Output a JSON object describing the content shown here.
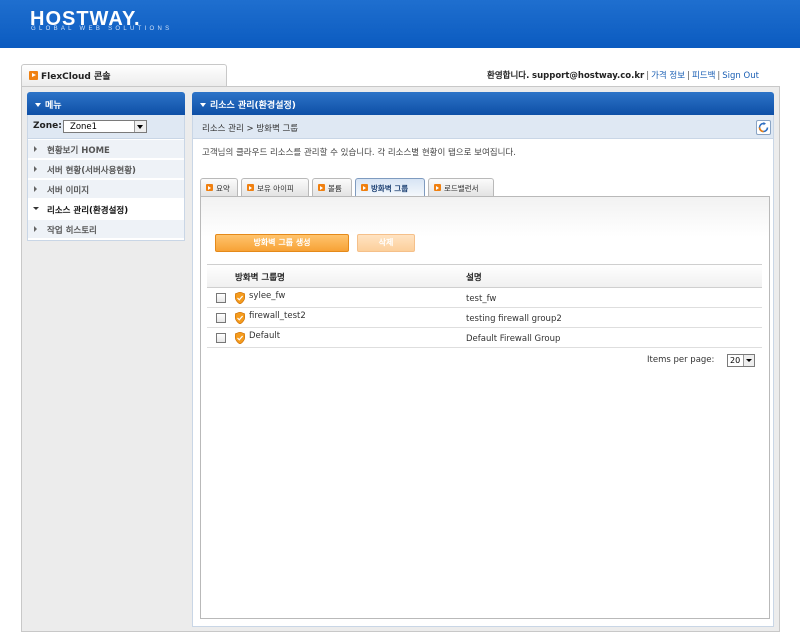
{
  "header": {
    "logo": "HOSTWAY.",
    "logo_sub": "GLOBAL WEB SOLUTIONS"
  },
  "app_tab": {
    "label": "FlexCloud 콘솔"
  },
  "user_bar": {
    "welcome": "환영합니다.",
    "email": "support@hostway.co.kr",
    "links": [
      "가격 정보",
      "피드백",
      "Sign Out"
    ]
  },
  "sidebar": {
    "title": "메뉴",
    "zone_label": "Zone:",
    "zone_value": "Zone1",
    "items": [
      {
        "label": "현황보기 HOME",
        "active": false
      },
      {
        "label": "서버 현황(서버사용현황)",
        "active": false
      },
      {
        "label": "서버 이미지",
        "active": false
      },
      {
        "label": "리소스 관리(환경설정)",
        "active": true
      },
      {
        "label": "작업 히스토리",
        "active": false
      }
    ]
  },
  "main": {
    "title": "리소스 관리(환경설정)",
    "breadcrumb": "리소스 관리 >  방화벽 그룹",
    "description": "고객님의 클라우드 리소스를 관리할 수 있습니다. 각 리소스별 현황이 탭으로 보여집니다.",
    "tabs": [
      {
        "label": "요약",
        "active": false
      },
      {
        "label": "보유 아이피",
        "active": false
      },
      {
        "label": "볼륨",
        "active": false
      },
      {
        "label": "방화벽 그룹",
        "active": true
      },
      {
        "label": "로드밸런서",
        "active": false
      }
    ],
    "buttons": {
      "create": "방화벽 그룹 생성",
      "delete": "삭제"
    },
    "table": {
      "columns": [
        "방화벽 그룹명",
        "설명"
      ],
      "rows": [
        {
          "name": "sylee_fw",
          "description": "test_fw"
        },
        {
          "name": "firewall_test2",
          "description": "testing firewall group2"
        },
        {
          "name": "Default",
          "description": "Default Firewall Group"
        }
      ]
    },
    "pagination": {
      "label": "Items per page:",
      "value": "20"
    }
  },
  "colors": {
    "header_blue": "#0b5bc0",
    "panel_blue": "#1a5fb4",
    "accent_orange": "#f08010"
  }
}
